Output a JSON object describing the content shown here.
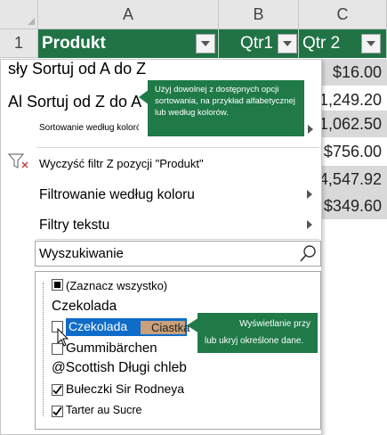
{
  "grid": {
    "columns": [
      "A",
      "B",
      "C"
    ],
    "row_number": "1",
    "headers": {
      "a": "Produkt",
      "b": "Qtr1",
      "c": "Qtr 2"
    },
    "values": [
      "$16.00",
      "$1,249.20",
      "$1,062.50",
      "$756.00",
      "4,547.92",
      "$349.60"
    ]
  },
  "menu": {
    "sort_asc": "sły Sortuj od A do Z",
    "sort_desc": "Al Sortuj od Z do A",
    "sort_by_color": "Sortowanie według kolorów",
    "clear_filter": "Wyczyść filtr  Z pozycji \"Produkt\"",
    "filter_by_color": "Filtrowanie według koloru",
    "text_filters": "Filtry tekstu",
    "search_placeholder": "Wyszukiwanie"
  },
  "list": {
    "select_all": "(Zaznacz wszystko)",
    "group1": "Czekolada",
    "item_selected": "Czekolada",
    "item_selected_tag": "Ciastka",
    "item_gummi": "Gummibärchen",
    "group2": "@Scottish Długi chleb",
    "item_rodney": "Bułeczki Sir Rodneya",
    "item_tarter": "Tarter au Sucre"
  },
  "tooltips": {
    "sort_tip": "Użyj dowolnej z dostępnych opcji sortowania, na przykład alfabetycznej lub według kolorów.",
    "show_tip_line1": "Wyświetlanie przy",
    "show_tip_line2": "lub ukryj określone dane."
  },
  "colors": {
    "header_green": "#217346",
    "tooltip_green": "#1f7a48",
    "selection_blue": "#0f6cc9"
  }
}
